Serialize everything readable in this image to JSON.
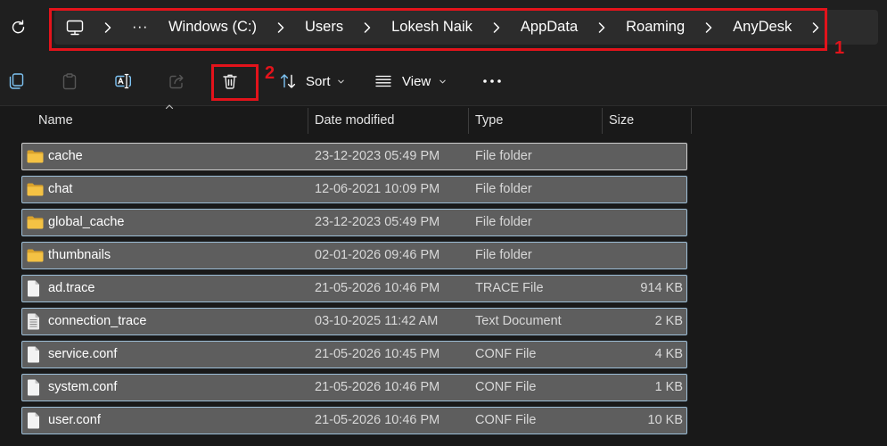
{
  "colors": {
    "annotation": "#e3131b",
    "folder": "#f4c244",
    "row_selected_bg": "#5e5e5e",
    "row_selected_border": "#9dbfd8",
    "accent": "#7ec4f4"
  },
  "address_bar": {
    "root_icon": "this-pc-icon",
    "overflow_label": "···",
    "crumbs": [
      "Windows (C:)",
      "Users",
      "Lokesh Naik",
      "AppData",
      "Roaming",
      "AnyDesk"
    ]
  },
  "toolbar": {
    "buttons": [
      {
        "icon": "copy-icon",
        "enabled": true
      },
      {
        "icon": "paste-icon",
        "enabled": false
      },
      {
        "icon": "rename-icon",
        "enabled": true
      },
      {
        "icon": "share-icon",
        "enabled": false
      },
      {
        "icon": "delete-icon",
        "enabled": true
      }
    ],
    "sort_label": "Sort",
    "view_label": "View"
  },
  "annotations": {
    "address_bar_label": "1",
    "delete_button_label": "2"
  },
  "columns": {
    "name": "Name",
    "date": "Date modified",
    "type": "Type",
    "size": "Size"
  },
  "sort_indicator_icon": "sort-chevron-up-icon",
  "files": [
    {
      "icon": "folder-icon",
      "name": "cache",
      "date": "23-12-2023 05:49 PM",
      "type": "File folder",
      "selected": true,
      "focused": true
    },
    {
      "icon": "folder-icon",
      "name": "chat",
      "date": "12-06-2021 10:09 PM",
      "type": "File folder",
      "selected": true
    },
    {
      "icon": "folder-icon",
      "name": "global_cache",
      "date": "23-12-2023 05:49 PM",
      "type": "File folder",
      "selected": true
    },
    {
      "icon": "folder-icon",
      "name": "thumbnails",
      "date": "02-01-2026 09:46 PM",
      "type": "File folder",
      "selected": true
    },
    {
      "icon": "file-icon",
      "name": "ad.trace",
      "date": "21-05-2026 10:46 PM",
      "type": "TRACE File",
      "size": "914 KB",
      "selected": true
    },
    {
      "icon": "text-file-icon",
      "name": "connection_trace",
      "date": "03-10-2025 11:42 AM",
      "type": "Text Document",
      "size": "2 KB",
      "selected": true
    },
    {
      "icon": "file-icon",
      "name": "service.conf",
      "date": "21-05-2026 10:45 PM",
      "type": "CONF File",
      "size": "4 KB",
      "selected": true
    },
    {
      "icon": "file-icon",
      "name": "system.conf",
      "date": "21-05-2026 10:46 PM",
      "type": "CONF File",
      "size": "1 KB",
      "selected": true
    },
    {
      "icon": "file-icon",
      "name": "user.conf",
      "date": "21-05-2026 10:46 PM",
      "type": "CONF File",
      "size": "10 KB",
      "selected": true
    }
  ]
}
